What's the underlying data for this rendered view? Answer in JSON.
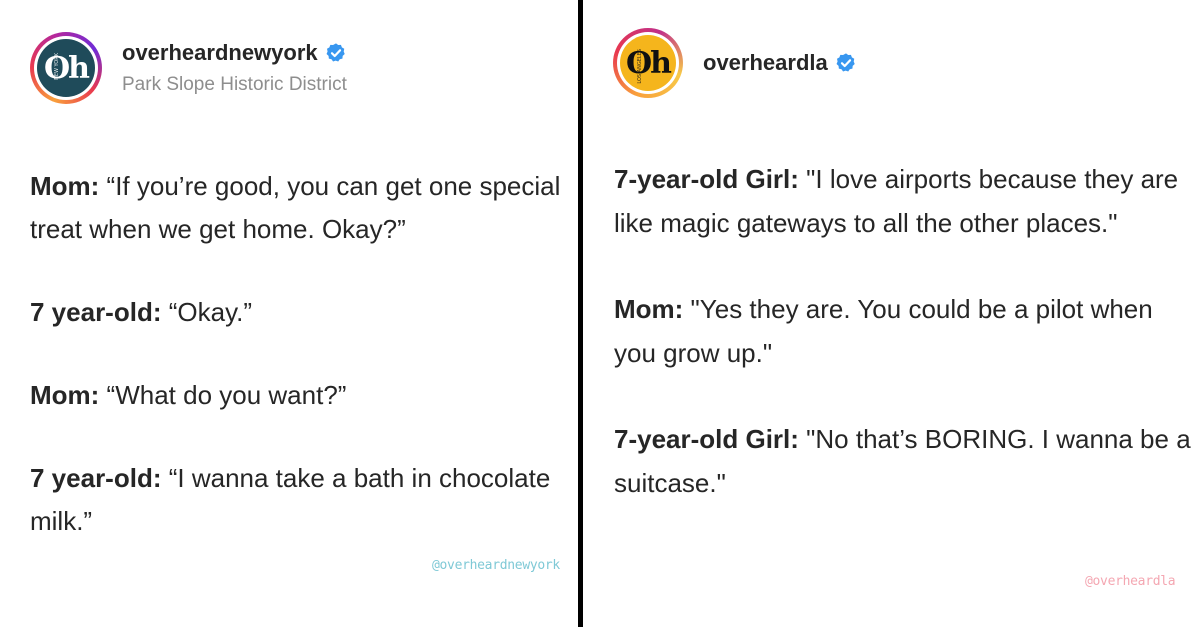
{
  "left_post": {
    "avatar_text": "Oh",
    "avatar_tiny": "NEW YORK",
    "username": "overheardnewyork",
    "location": "Park Slope Historic District",
    "lines": [
      {
        "speaker": "Mom:",
        "text": " “If you’re good, you can get one special treat when we get home. Okay?”"
      },
      {
        "speaker": "7 year-old:",
        "text": " “Okay.”"
      },
      {
        "speaker": "Mom:",
        "text": " “What do you want?”"
      },
      {
        "speaker": "7 year-old:",
        "text": " “I wanna take a bath in chocolate milk.”"
      }
    ],
    "watermark": "@overheardnewyork"
  },
  "right_post": {
    "avatar_text": "Oh",
    "avatar_tiny": "LOS ANGELES",
    "username": "overheardla",
    "lines": [
      {
        "speaker": "7-year-old Girl:",
        "text": " \"I love airports because they are like magic gateways to all the other places.\""
      },
      {
        "speaker": "Mom:",
        "text": " \"Yes they are. You could be a pilot when you grow up.\""
      },
      {
        "speaker": "7-year-old Girl:",
        "text": " \"No that’s BORING. I wanna be a suitcase.\""
      }
    ],
    "watermark": "@overheardla"
  },
  "colors": {
    "verified_badge": "#3897f0",
    "divider": "#000000",
    "ny_avatar_bg": "#1f4b5a",
    "la_avatar_bg": "#f5b51c",
    "ny_watermark": "#7fc9d6",
    "la_watermark": "#f4a7b2"
  },
  "icons": [
    "verified-badge-icon"
  ]
}
